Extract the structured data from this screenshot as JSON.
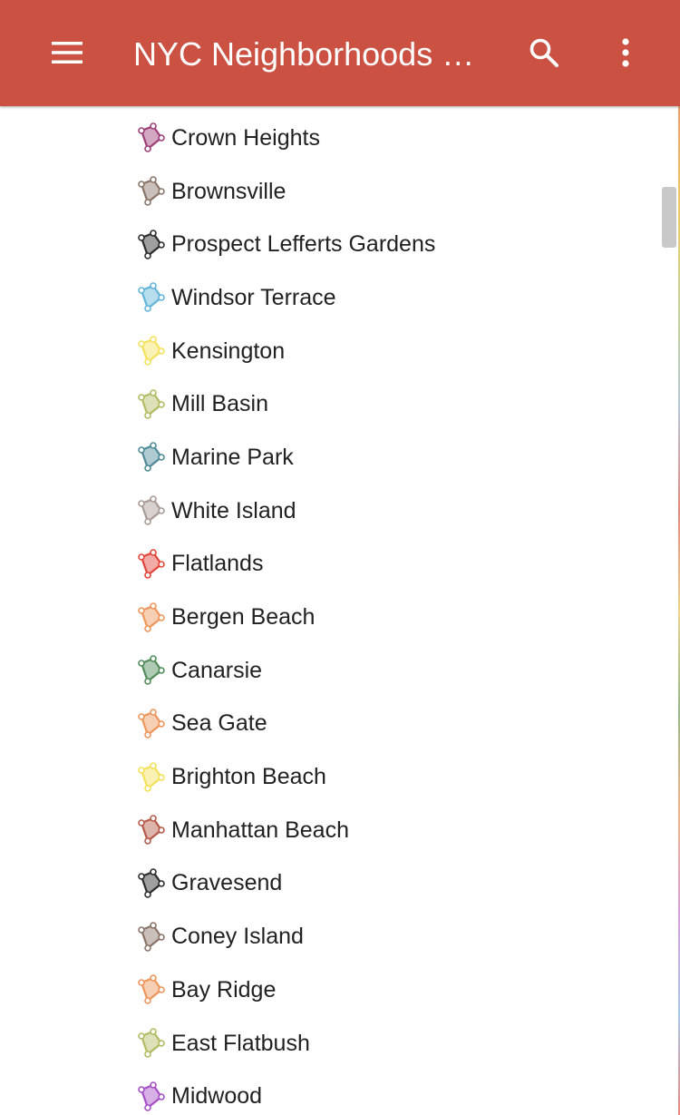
{
  "app_bar": {
    "title": "NYC Neighborhoods Map",
    "background_color": "#cb5143",
    "menu_icon": "hamburger-menu-icon",
    "search_icon": "search-icon",
    "more_icon": "more-vert-icon"
  },
  "neighborhoods": [
    {
      "name": "Crown Heights",
      "color": "#9e3f7a"
    },
    {
      "name": "Brownsville",
      "color": "#8a7468"
    },
    {
      "name": "Prospect Lefferts Gardens",
      "color": "#2b2b2b"
    },
    {
      "name": "Windsor Terrace",
      "color": "#62b4d8"
    },
    {
      "name": "Kensington",
      "color": "#f4e15a"
    },
    {
      "name": "Mill Basin",
      "color": "#b3ba62"
    },
    {
      "name": "Marine Park",
      "color": "#4f8a98"
    },
    {
      "name": "White Island",
      "color": "#a89a94"
    },
    {
      "name": "Flatlands",
      "color": "#e2453a"
    },
    {
      "name": "Bergen Beach",
      "color": "#ee955a"
    },
    {
      "name": "Canarsie",
      "color": "#4f8c58"
    },
    {
      "name": "Sea Gate",
      "color": "#ee955a"
    },
    {
      "name": "Brighton Beach",
      "color": "#f4e15a"
    },
    {
      "name": "Manhattan Beach",
      "color": "#b55a4a"
    },
    {
      "name": "Gravesend",
      "color": "#2b2b2b"
    },
    {
      "name": "Coney Island",
      "color": "#8a7468"
    },
    {
      "name": "Bay Ridge",
      "color": "#ee955a"
    },
    {
      "name": "East Flatbush",
      "color": "#b3ba62"
    },
    {
      "name": "Midwood",
      "color": "#a64fc8"
    }
  ]
}
